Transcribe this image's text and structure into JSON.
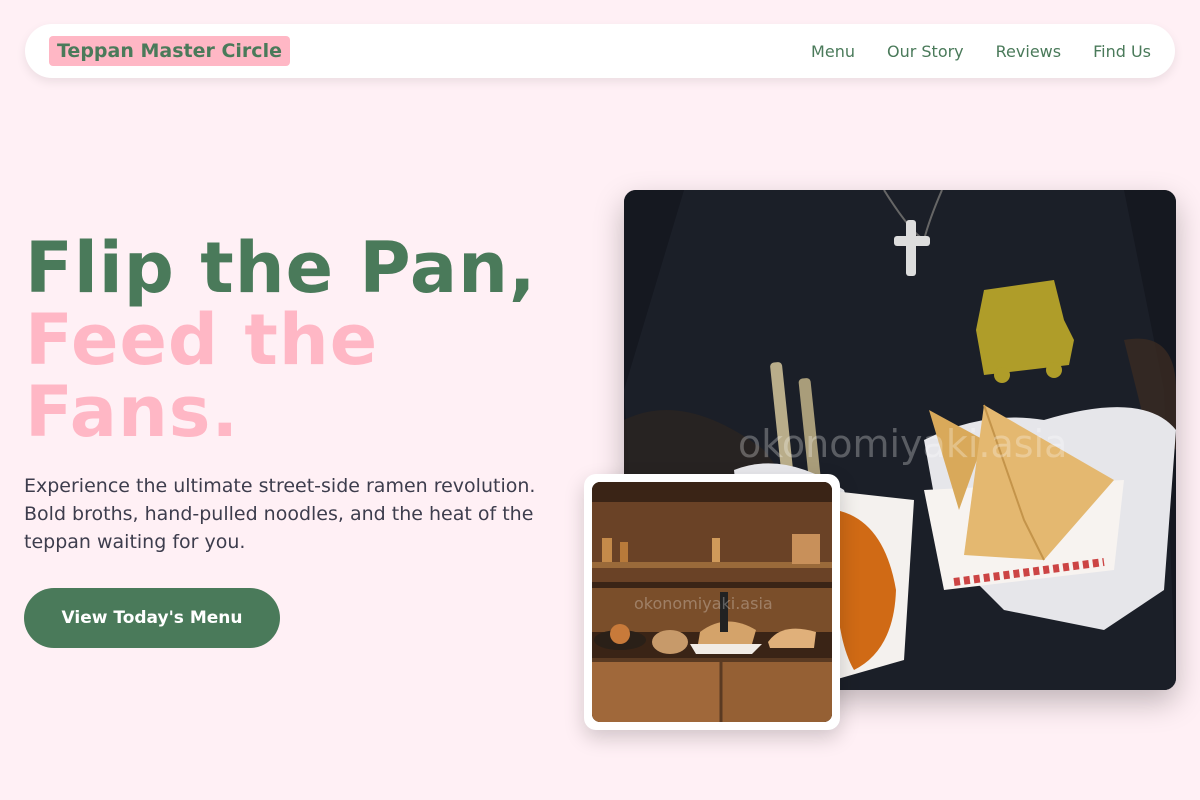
{
  "nav": {
    "brand": "Teppan Master Circle",
    "links": [
      "Menu",
      "Our Story",
      "Reviews",
      "Find Us"
    ]
  },
  "hero": {
    "title_line1": "Flip the Pan,",
    "title_line2": "Feed the Fans.",
    "subtitle": "Experience the ultimate street-side ramen revolution. Bold broths, hand-pulled noodles, and the heat of the teppan waiting for you.",
    "cta_label": "View Today's Menu"
  },
  "images": {
    "main_watermark": "okonomiyaki.asia",
    "small_watermark": "okonomiyaki.asia"
  },
  "colors": {
    "background": "#fff0f5",
    "green": "#4a7a5a",
    "pink": "#ffb7c5"
  }
}
